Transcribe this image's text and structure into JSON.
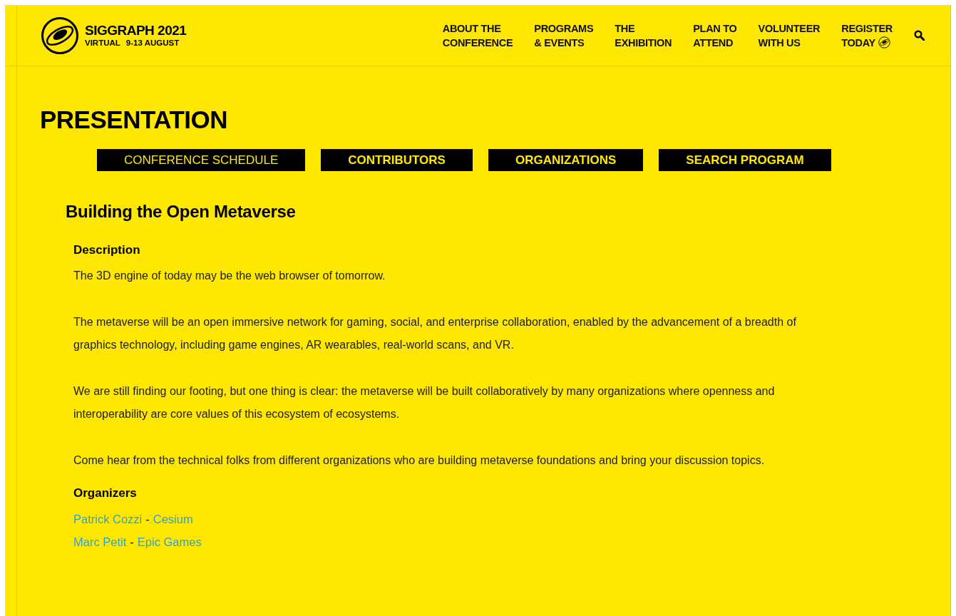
{
  "logo": {
    "title": "SIGGRAPH 2021",
    "subtitle_left": "VIRTUAL",
    "subtitle_right": "9-13 AUGUST"
  },
  "nav": [
    {
      "lines": [
        "ABOUT THE",
        "CONFERENCE"
      ],
      "kind": "plain"
    },
    {
      "lines": [
        "PROGRAMS",
        "& EVENTS"
      ],
      "kind": "plain"
    },
    {
      "lines": [
        "THE",
        "EXHIBITION"
      ],
      "kind": "plain"
    },
    {
      "lines": [
        "PLAN TO",
        "ATTEND"
      ],
      "kind": "plain"
    },
    {
      "lines": [
        "VOLUNTEER",
        "WITH US"
      ],
      "kind": "plain"
    },
    {
      "lines": [
        "REGISTER",
        "TODAY"
      ],
      "kind": "badge"
    }
  ],
  "page_title": "PRESENTATION",
  "tabs": [
    {
      "label": "CONFERENCE SCHEDULE",
      "selected": true
    },
    {
      "label": "CONTRIBUTORS",
      "selected": false
    },
    {
      "label": "ORGANIZATIONS",
      "selected": false
    },
    {
      "label": "SEARCH PROGRAM",
      "selected": false
    }
  ],
  "presentation": {
    "title": "Building the Open Metaverse",
    "description_heading": "Description",
    "paragraphs": [
      "The 3D engine of today may be the web browser of tomorrow.",
      "The metaverse will be an open immersive network for gaming, social, and enterprise collaboration, enabled by the advancement of a breadth of graphics technology, including game engines, AR wearables, real-world scans, and VR.",
      "We are still finding our footing, but one thing is clear: the metaverse will be built collaboratively by many organizations where openness and interoperability are core values of this ecosystem of ecosystems.",
      "Come hear from the technical folks from different organizations who are building metaverse foundations and bring your discussion topics."
    ],
    "organizers_heading": "Organizers",
    "organizers": [
      {
        "name": "Patrick Cozzi",
        "separator": "-",
        "organization": "Cesium"
      },
      {
        "name": "Marc Petit",
        "separator": "-",
        "organization": "Epic Games"
      }
    ]
  }
}
